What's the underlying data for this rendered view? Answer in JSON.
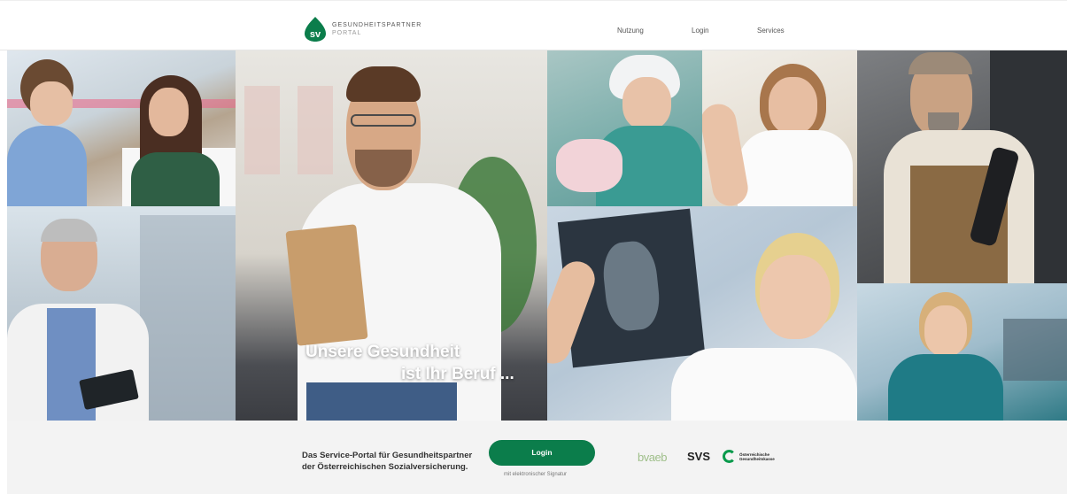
{
  "header": {
    "logo_line1": "GESUNDHEITSPARTNER",
    "logo_line2": "PORTAL",
    "logo_mark": "sv",
    "nav": [
      "Nutzung",
      "Login",
      "Services"
    ]
  },
  "hero": {
    "headline_line1": "Unsere Gesundheit",
    "headline_line2": "ist Ihr Beruf ..."
  },
  "footer": {
    "tagline_line1": "Das Service-Portal für Gesundheitspartner",
    "tagline_line2": "der Österreichischen Sozialversicherung.",
    "login_label": "Login",
    "signature_note": "mit elektronischer Signatur",
    "partners": {
      "bvaeb": "bvaeb",
      "svs": "SVS",
      "oegk_line1": "Österreichische",
      "oegk_line2": "Gesundheitskasse"
    }
  },
  "colors": {
    "brand_green": "#0b7d4b",
    "oegk_green": "#0a9a4c",
    "bvaeb_green": "#9fbf8a"
  },
  "icons": [
    "sv-logo-icon",
    "oegk-logo-icon"
  ]
}
